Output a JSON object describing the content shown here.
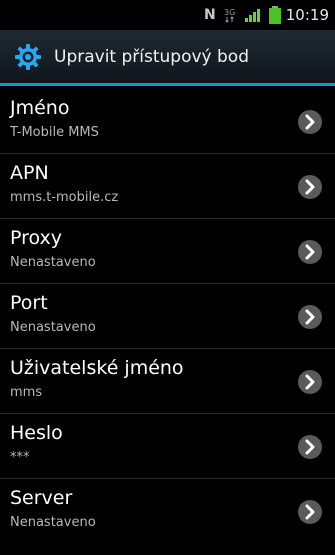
{
  "status_bar": {
    "nfc_label": "N",
    "time": "10:19"
  },
  "header": {
    "title": "Upravit přístupový bod",
    "icon": "gear-icon",
    "accent_color": "#1a8fd6"
  },
  "items": [
    {
      "title": "Jméno",
      "value": "T-Mobile MMS"
    },
    {
      "title": "APN",
      "value": "mms.t-mobile.cz"
    },
    {
      "title": "Proxy",
      "value": "Nenastaveno"
    },
    {
      "title": "Port",
      "value": "Nenastaveno"
    },
    {
      "title": "Uživatelské jméno",
      "value": "mms"
    },
    {
      "title": "Heslo",
      "value": "***"
    },
    {
      "title": "Server",
      "value": "Nenastaveno"
    }
  ]
}
